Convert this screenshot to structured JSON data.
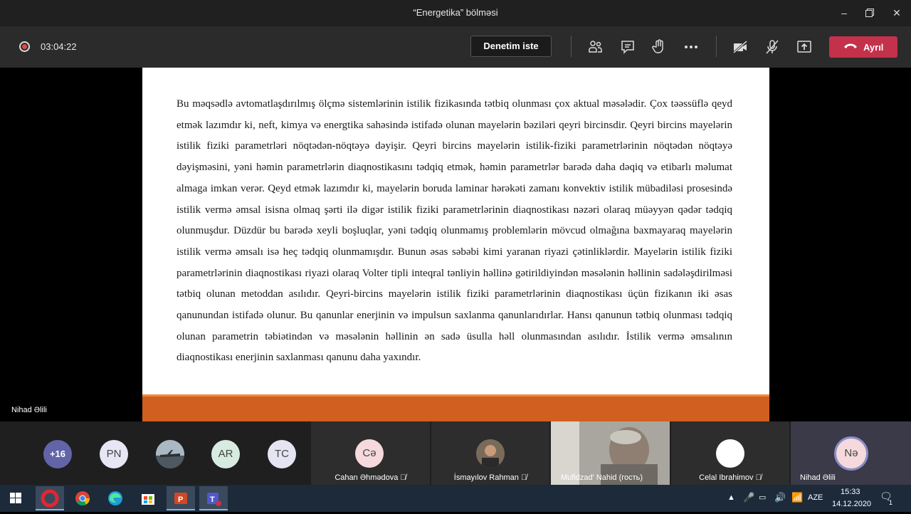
{
  "window": {
    "title": "“Energetika” bölməsi",
    "minimize": "–",
    "maximize": "❐",
    "close": "✕"
  },
  "toolbar": {
    "timer": "03:04:22",
    "request_control_label": "Denetim iste",
    "leave_label": "Ayrıl",
    "icons": [
      "participants-icon",
      "chat-icon",
      "raise-hand-icon",
      "more-options-icon",
      "camera-off-icon",
      "mic-off-icon",
      "share-screen-icon"
    ]
  },
  "slide": {
    "text": "Bu məqsədlə  avtomatlaşdırılmış ölçmə sistemlərinin  istilik fizikasında tətbiq olunması çox aktual məsələdir. Çox təəssüflə qeyd etmək lazımdır ki, neft, kimya və energtika  sahəsində  istifadə olunan mayelərin  bəziləri  qeyri bircinsdir. Qeyri bircins mayelərin istilik fiziki parametrləri nöqtədən-nöqtəyə  dəyişir. Qeyri bircins mayelərin istilik-fiziki parametrlərinin nöqtədən nöqtəyə dəyişməsini, yəni həmin parametrlərin  diaqnostikasını tədqiq etmək, həmin parametrlər  barədə  daha dəqiq və etibarlı məlumat almaga imkan verər. Qeyd etmək lazımdır ki, mayelərin boruda laminar hərəkəti zamanı  konvektiv istilik mübadiləsi prosesində istilik vermə əmsal isisna olmaq şərti ilə digər istilik fiziki parametrlərinin diaqnostikası nəzəri olaraq müəyyən  qədər tədqiq olunmuşdur. Düzdür bu barədə xeyli boşluqlar, yəni tədqiq olunmamış problemlərin mövcud olmağına baxmayaraq mayelərin istilik vermə əmsalı isə heç tədqiq olunmamışdır. Bunun əsas səbəbi kimi yaranan riyazi çətinliklərdir. Mayelərin istilik fiziki parametrlərinin diaqnostikası  riyazi olaraq Volter tipli inteqral tənliyin  həllinə gətirildiyindən  məsələnin həllinin sadələşdirilməsi tətbiq olunan  metoddan asılıdır. Qeyri-bircins mayelərin  istilik fiziki parametrlərinin  diaqnostikası üçün fizikanın iki əsas qanunundan istifadə olunur. Bu qanunlar enerjinin və impulsun saxlanma qanunlarıdırlar. Hansı qanunun  tətbiq olunması  tədqiq olunan parametrin  təbiətindən və məsələnin  həllinin ən sadə üsulla həll olunmasından asılıdır. İstilik vermə əmsalının diaqnostikası  enerjinin  saxlanması qanunu daha yaxındır."
  },
  "presenter_name": "Nihad Əlili",
  "participants": {
    "overflow": "+16",
    "initials": [
      "PN",
      "AR",
      "TC"
    ],
    "tiles": [
      {
        "initials": "Cə",
        "name": "Cahan Əhmədova"
      },
      {
        "initials": "",
        "name": "İsmayılov Rahman"
      },
      {
        "initials": "",
        "name": "Mufidzad' Nahid (гость)"
      },
      {
        "initials": "",
        "name": "Celal Ibrahimov"
      },
      {
        "initials": "Nə",
        "name": "Nihad Əlili"
      }
    ]
  },
  "taskbar": {
    "language": "AZE",
    "time": "15:33",
    "date": "14.12.2020",
    "notifications": "1"
  },
  "colors": {
    "leave": "#c4314b",
    "slide_bar": "#d15f1f",
    "avatar_purple": "#6264a7"
  }
}
